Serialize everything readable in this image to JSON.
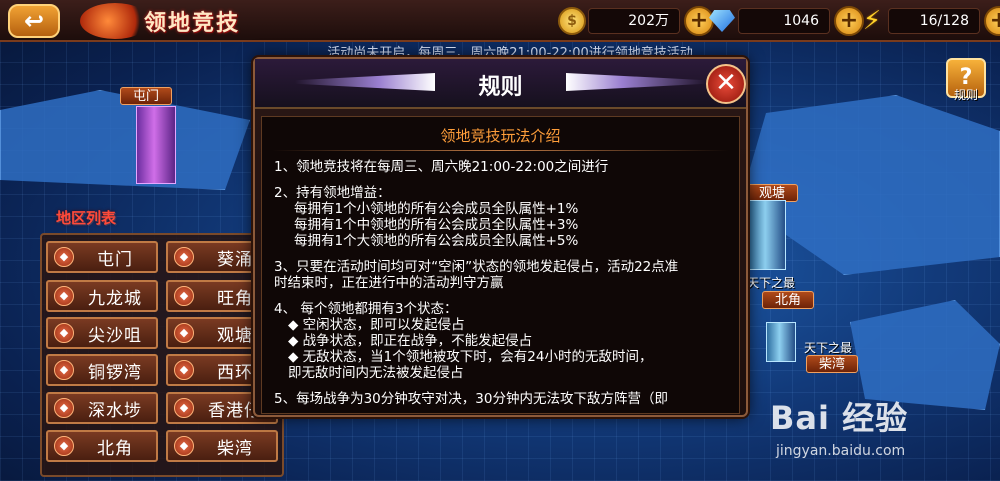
{
  "topbar": {
    "back_icon": "back-arrow-icon",
    "title": "领地竞技",
    "resources": [
      {
        "icon": "gold-coin-icon",
        "value": "202万"
      },
      {
        "icon": "diamond-icon",
        "value": "1046"
      },
      {
        "icon": "energy-bolt-icon",
        "value": "16/128"
      }
    ]
  },
  "notice": "活动尚未开启，每周三、周六晚21:00-22:00进行领地竞技活动",
  "map": {
    "locations": {
      "tunmen": "屯门",
      "guantang": "观塘",
      "beijiao": "北角",
      "chaiwan": "柴湾"
    },
    "titles": {
      "beijiao_title": "天下之最",
      "chaiwan_title": "天下之最"
    },
    "rules_button": "规则"
  },
  "region_list": {
    "title": "地区列表",
    "items": [
      {
        "label": "屯门"
      },
      {
        "label": "葵涌"
      },
      {
        "label": "九龙城"
      },
      {
        "label": "旺角"
      },
      {
        "label": "尖沙咀"
      },
      {
        "label": "观塘"
      },
      {
        "label": "铜锣湾"
      },
      {
        "label": "西环"
      },
      {
        "label": "深水埗"
      },
      {
        "label": "香港仔"
      },
      {
        "label": "北角"
      },
      {
        "label": "柴湾"
      }
    ]
  },
  "modal": {
    "title": "规则",
    "heading": "领地竞技玩法介绍",
    "lines": [
      "1、领地竞技将在每周三、周六晚21:00-22:00之间进行",
      "2、持有领地增益：",
      "每拥有1个小领地的所有公会成员全队属性+1%",
      "每拥有1个中领地的所有公会成员全队属性+3%",
      "每拥有1个大领地的所有公会成员全队属性+5%",
      "3、只要在活动时间均可对“空闲”状态的领地发起侵占，活动22点准",
      "时结束时，正在进行中的活动判守方赢",
      "4、 每个领地都拥有3个状态：",
      "◆ 空闲状态，即可以发起侵占",
      "◆ 战争状态，即正在战争，不能发起侵占",
      "◆ 无敌状态，当1个领地被攻下时，会有24小时的无敌时间，",
      "即无敌时间内无法被发起侵占",
      "5、每场战争为30分钟攻守对决，30分钟内无法攻下敌方阵营（即"
    ]
  },
  "watermark": {
    "logo": "Bai 经验",
    "url": "jingyan.baidu.com"
  }
}
